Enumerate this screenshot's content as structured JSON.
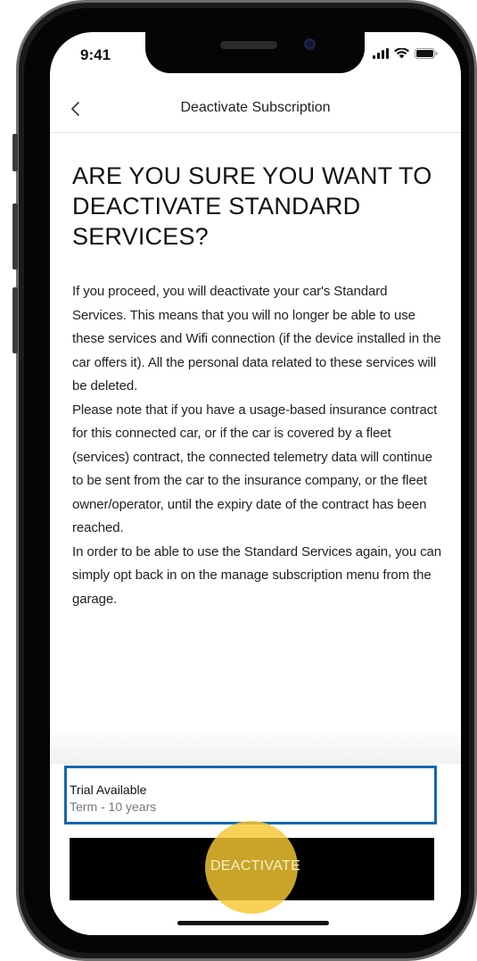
{
  "status_bar": {
    "time": "9:41"
  },
  "header": {
    "title": "Deactivate Subscription",
    "back_icon": "chevron-left-icon"
  },
  "main": {
    "heading": "ARE YOU SURE YOU WANT TO DEACTIVATE STANDARD SERVICES?",
    "body": "If you proceed, you will deactivate your car's Standard Services. This means that you will no longer be able to use these services and Wifi connection (if the device installed in the car offers it). All the personal data related to these services will be deleted.\nPlease note that if you have a usage-based insurance contract for this connected car, or if the car is covered by a fleet (services) contract, the connected telemetry data will continue to be sent from the car to the insurance company, or the fleet owner/operator, until the expiry date of the contract has been reached.\nIn order to be able to use the Standard Services again, you can simply opt back in on the manage subscription menu from the garage."
  },
  "subscription": {
    "title": "Trial Available",
    "term": "Term - 10 years"
  },
  "actions": {
    "deactivate_label": "DEACTIVATE"
  },
  "colors": {
    "highlight_border": "#1766b0",
    "button_bg": "#000000",
    "tap_indicator": "#f5c832"
  }
}
